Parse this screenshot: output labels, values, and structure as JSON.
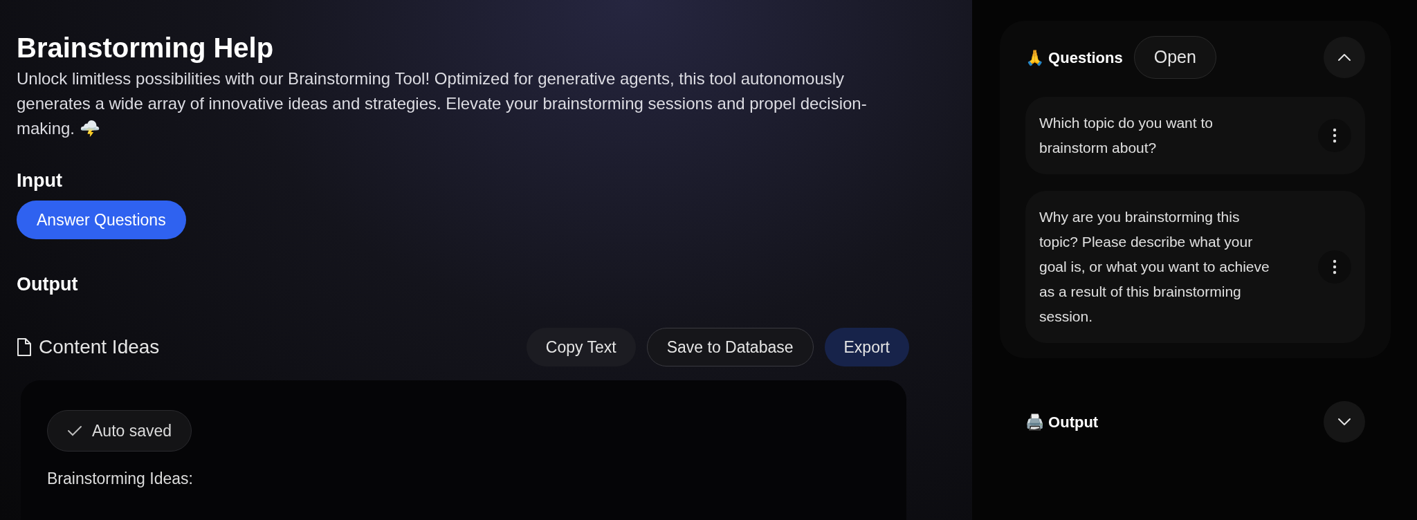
{
  "main": {
    "title": "Brainstorming Help",
    "description": "Unlock limitless possibilities with our Brainstorming Tool! Optimized for generative agents, this tool autonomously generates a wide array of innovative ideas and strategies. Elevate your brainstorming sessions and propel decision-making. 🌩️",
    "input_heading": "Input",
    "input_button": "Answer Questions",
    "output_heading": "Output",
    "document_title": "Content Ideas",
    "actions": [
      {
        "label": "Copy Text",
        "kind": "secondary"
      },
      {
        "label": "Save to Database",
        "kind": "outline"
      },
      {
        "label": "Export",
        "kind": "primary"
      }
    ],
    "status": "Auto saved",
    "content": "Brainstorming Ideas:"
  },
  "sidebar": {
    "sections": [
      {
        "title": "🙏 Questions",
        "badge": "Open",
        "expanded": true,
        "questions": [
          "Which topic do you want to brainstorm about?",
          "Why are you brainstorming this topic? Please describe what your goal is, or what you want to achieve as a result of this brainstorming session."
        ]
      },
      {
        "title": "🖨️ Output",
        "expanded": false
      }
    ]
  }
}
